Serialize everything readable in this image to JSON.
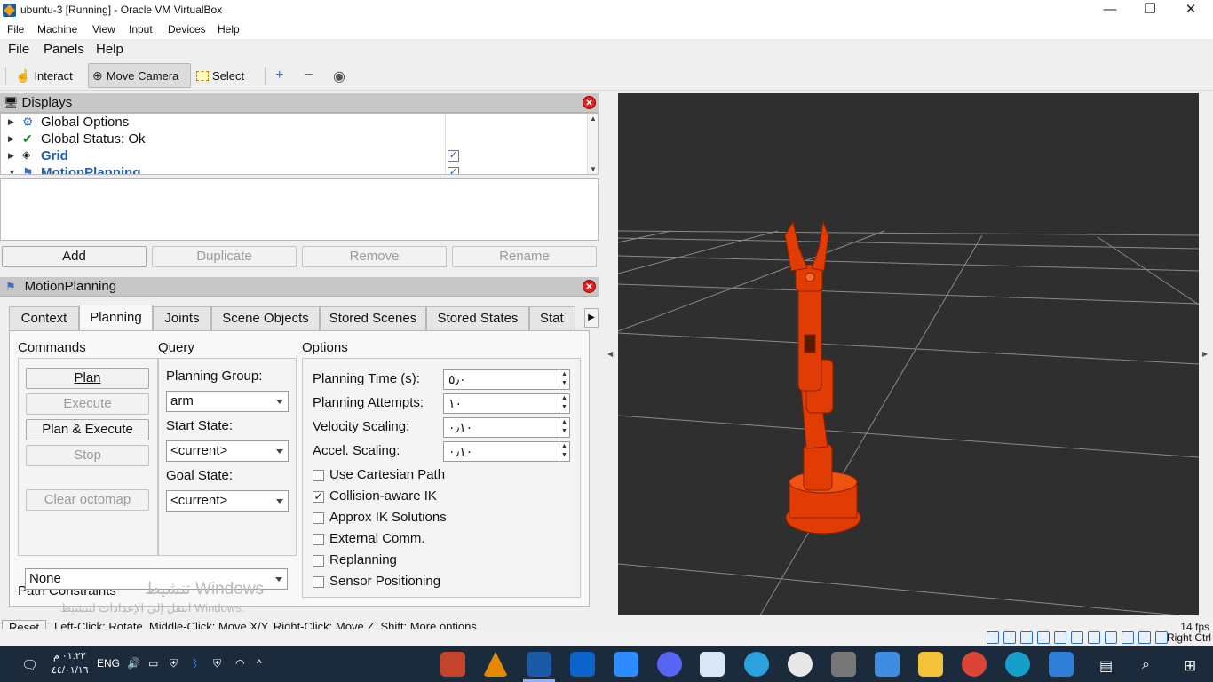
{
  "host": {
    "window_title": "ubuntu-3 [Running] - Oracle VM VirtualBox",
    "menu": [
      "File",
      "Machine",
      "View",
      "Input",
      "Devices",
      "Help"
    ],
    "controls": [
      "—",
      "❐",
      "✕"
    ],
    "status": {
      "fps": "14 fps",
      "host_key": "Right Ctrl"
    }
  },
  "rviz": {
    "menu": [
      "File",
      "Panels",
      "Help"
    ],
    "tools": {
      "interact": "Interact",
      "move_camera": "Move Camera",
      "select": "Select"
    },
    "displays": {
      "title": "Displays",
      "items": [
        {
          "label": "Global Options",
          "icon": "gear-icon"
        },
        {
          "label": "Global Status: Ok",
          "icon": "checkmark-icon"
        },
        {
          "label": "Grid",
          "icon": "grid-icon",
          "checked": true
        },
        {
          "label": "MotionPlanning",
          "icon": "motion-planning-icon",
          "checked": true
        }
      ],
      "buttons": {
        "add": "Add",
        "duplicate": "Duplicate",
        "remove": "Remove",
        "rename": "Rename"
      }
    },
    "motion_planning": {
      "title": "MotionPlanning",
      "tabs": [
        "Context",
        "Planning",
        "Joints",
        "Scene Objects",
        "Stored Scenes",
        "Stored States",
        "Stat"
      ],
      "selected_tab": "Planning",
      "commands": {
        "title": "Commands",
        "plan": "Plan",
        "execute": "Execute",
        "plan_execute": "Plan & Execute",
        "stop": "Stop",
        "clear_octomap": "Clear octomap"
      },
      "query": {
        "title": "Query",
        "planning_group_label": "Planning Group:",
        "planning_group_value": "arm",
        "start_state_label": "Start State:",
        "start_state_value": "<current>",
        "goal_state_label": "Goal State:",
        "goal_state_value": "<current>"
      },
      "options": {
        "title": "Options",
        "planning_time_label": "Planning Time (s):",
        "planning_time_value": "٥٫٠",
        "planning_attempts_label": "Planning Attempts:",
        "planning_attempts_value": "١٠",
        "velocity_scaling_label": "Velocity Scaling:",
        "velocity_scaling_value": "٠٫١٠",
        "accel_scaling_label": "Accel. Scaling:",
        "accel_scaling_value": "٠٫١٠",
        "checkboxes": [
          {
            "label": "Use Cartesian Path",
            "checked": false
          },
          {
            "label": "Collision-aware IK",
            "checked": true
          },
          {
            "label": "Approx IK Solutions",
            "checked": false
          },
          {
            "label": "External Comm.",
            "checked": false
          },
          {
            "label": "Replanning",
            "checked": false
          },
          {
            "label": "Sensor Positioning",
            "checked": false
          }
        ]
      },
      "path_constraints": {
        "label": "Path Constraints",
        "value": "None"
      }
    },
    "status_bar": {
      "reset": "Reset",
      "hint": "Left-Click: Rotate. Middle-Click: Move X/Y. Right-Click: Move Z. Shift: More options."
    },
    "watermark": {
      "line1": "تنشيط Windows",
      "line2": "انتقل إلى الإعدادات لتنشيط Windows."
    }
  },
  "taskbar": {
    "time": "٠١:٢٣ م",
    "date": "٤٤/٠١/١٦",
    "language": "ENG"
  },
  "colors": {
    "robot": "#e23c05",
    "viewport_bg": "#2f2f2f",
    "grid": "#a0a0a0",
    "accent": "#1d5fb3"
  }
}
